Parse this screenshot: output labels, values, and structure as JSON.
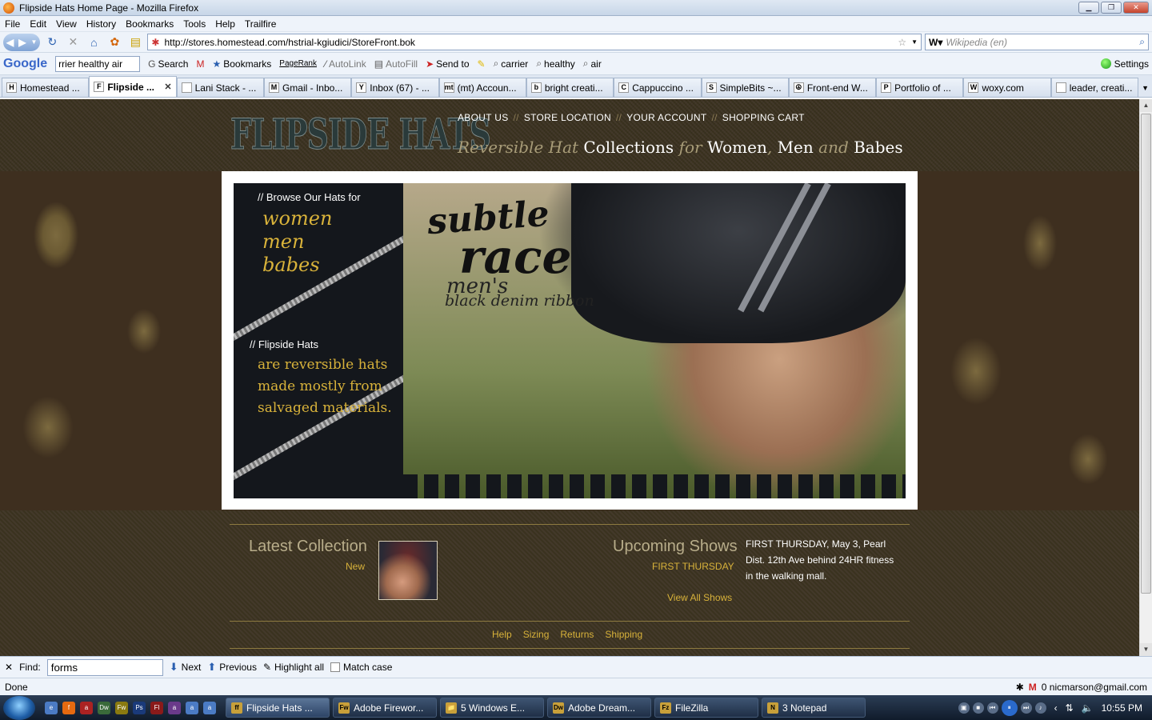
{
  "window": {
    "title": "Flipside Hats Home Page - Mozilla Firefox"
  },
  "menu": [
    "File",
    "Edit",
    "View",
    "History",
    "Bookmarks",
    "Tools",
    "Help",
    "Trailfire"
  ],
  "nav": {
    "url": "http://stores.homestead.com/hstrial-kgiudici/StoreFront.bok",
    "search_placeholder": "Wikipedia (en)"
  },
  "google_toolbar": {
    "logo": "Google",
    "query": "rrier healthy air",
    "items": [
      "Search",
      "Bookmarks",
      "PageRank",
      "AutoLink",
      "AutoFill",
      "Send to",
      "carrier",
      "healthy",
      "air"
    ],
    "settings": "Settings"
  },
  "tabs": [
    {
      "label": "Homestead ...",
      "icon": "H"
    },
    {
      "label": "Flipside ...",
      "icon": "F",
      "active": true
    },
    {
      "label": "Lani Stack - ...",
      "icon": ""
    },
    {
      "label": "Gmail - Inbo...",
      "icon": "M"
    },
    {
      "label": "Inbox (67) - ...",
      "icon": "Y"
    },
    {
      "label": "(mt) Accoun...",
      "icon": "mt"
    },
    {
      "label": "bright creati...",
      "icon": "b"
    },
    {
      "label": "Cappuccino ...",
      "icon": "C"
    },
    {
      "label": "SimpleBits ~...",
      "icon": "S"
    },
    {
      "label": "Front-end W...",
      "icon": "☮"
    },
    {
      "label": "Portfolio of ...",
      "icon": "P"
    },
    {
      "label": "woxy.com",
      "icon": "W"
    },
    {
      "label": "leader, creati...",
      "icon": ""
    }
  ],
  "site": {
    "logo": "FLIPSIDE HATS",
    "nav": [
      "ABOUT US",
      "STORE LOCATION",
      "YOUR ACCOUNT",
      "SHOPPING CART"
    ],
    "nav_sep": "//",
    "tagline": {
      "p1": "Reversible Hat",
      "p2": "Collections",
      "p3": "for",
      "p4": "Women",
      "p5": ",",
      "p6": "Men",
      "p7": "and",
      "p8": "Babes"
    },
    "browse_heading": "// Browse Our Hats for",
    "categories": [
      "women",
      "men",
      "babes"
    ],
    "about_heading": "// Flipside Hats",
    "about_lines": [
      "are reversible hats",
      "made mostly from",
      "salvaged materials."
    ],
    "hero": {
      "line1": "subtle",
      "line2": "race",
      "line3": "men's",
      "line4": "black denim ribbon"
    },
    "latest": {
      "heading": "Latest Collection",
      "sub": "New"
    },
    "shows": {
      "heading": "Upcoming Shows",
      "sub": "FIRST THURSDAY",
      "desc": "FIRST THURSDAY, May 3, Pearl Dist. 12th Ave behind 24HR fitness in the walking mall.",
      "link": "View All Shows"
    },
    "footer_links": [
      "Help",
      "Sizing",
      "Returns",
      "Shipping"
    ]
  },
  "findbar": {
    "label": "Find:",
    "value": "forms",
    "next": "Next",
    "previous": "Previous",
    "highlight": "Highlight all",
    "match_case": "Match case"
  },
  "status": {
    "text": "Done",
    "gmail": "0 nicmarson@gmail.com"
  },
  "taskbar": {
    "items": [
      {
        "label": "Flipside Hats ...",
        "icon": "ff",
        "active": true
      },
      {
        "label": "Adobe Firewor...",
        "icon": "Fw"
      },
      {
        "label": "5 Windows E...",
        "icon": "📁"
      },
      {
        "label": "Adobe Dream...",
        "icon": "Dw"
      },
      {
        "label": "FileZilla",
        "icon": "Fz"
      },
      {
        "label": "3 Notepad",
        "icon": "N"
      }
    ],
    "clock": "10:55 PM"
  }
}
